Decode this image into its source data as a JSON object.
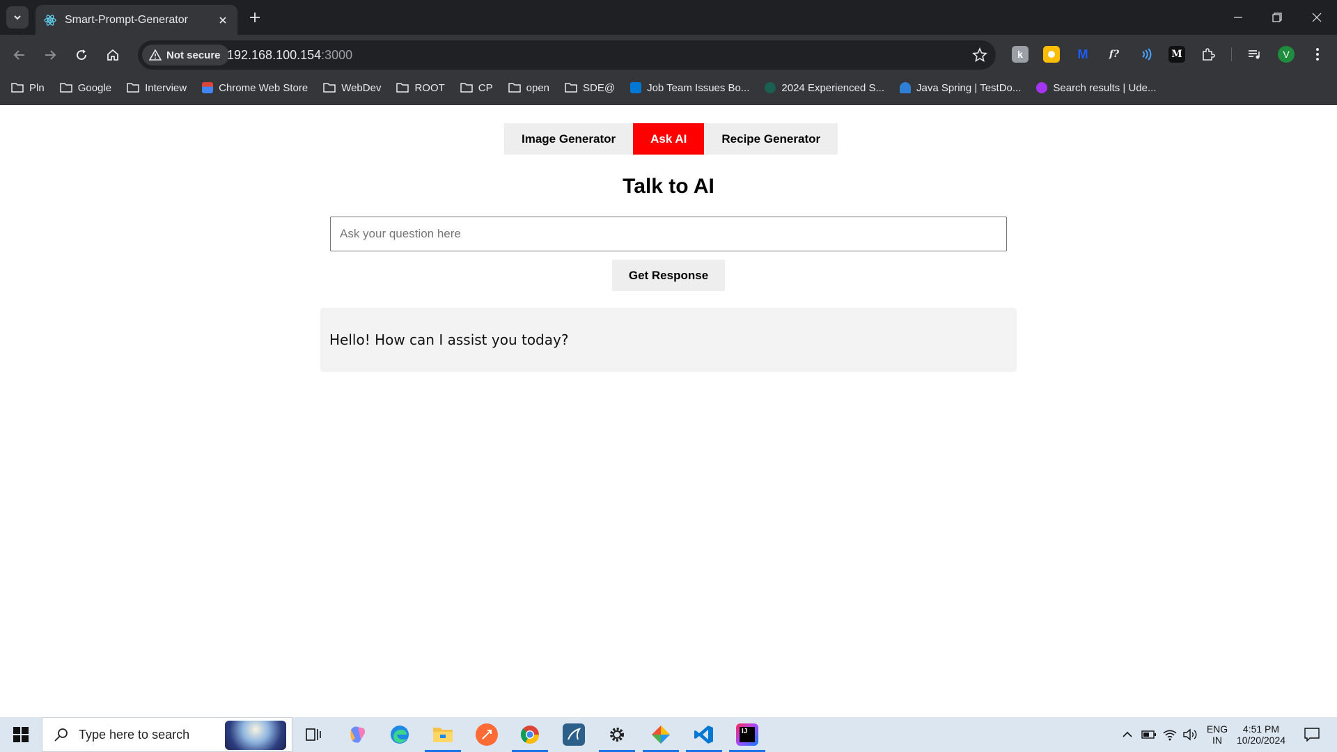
{
  "browser": {
    "tab_title": "Smart-Prompt-Generator",
    "security_label": "Not secure",
    "url_host": "192.168.100.154",
    "url_port": ":3000",
    "profile_initial": "V",
    "extensions": [
      "k-extension-icon",
      "yellow-extension-icon",
      "m-extension-icon",
      "fx-extension-icon",
      "wave-extension-icon",
      "medium-extension-icon"
    ],
    "bookmarks": [
      {
        "label": "Pln",
        "icon": "folder-icon"
      },
      {
        "label": "Google",
        "icon": "folder-icon"
      },
      {
        "label": "Interview",
        "icon": "folder-icon"
      },
      {
        "label": "Chrome Web Store",
        "icon": "chrome-web-store-icon"
      },
      {
        "label": "WebDev",
        "icon": "folder-icon"
      },
      {
        "label": "ROOT",
        "icon": "folder-icon"
      },
      {
        "label": "CP",
        "icon": "folder-icon"
      },
      {
        "label": "open",
        "icon": "folder-icon"
      },
      {
        "label": "SDE@",
        "icon": "folder-icon"
      },
      {
        "label": "Job Team Issues Bo...",
        "icon": "azure-devops-icon"
      },
      {
        "label": "2024 Experienced S...",
        "icon": "site-icon"
      },
      {
        "label": "Java Spring | TestDo...",
        "icon": "testdome-icon"
      },
      {
        "label": "Search results | Ude...",
        "icon": "udemy-icon"
      }
    ]
  },
  "app": {
    "tabs": [
      {
        "label": "Image Generator",
        "active": false
      },
      {
        "label": "Ask AI",
        "active": true
      },
      {
        "label": "Recipe Generator",
        "active": false
      }
    ],
    "title": "Talk to AI",
    "input_placeholder": "Ask your question here",
    "input_value": "",
    "button_label": "Get Response",
    "response": "Hello! How can I assist you today?",
    "accent_color": "#ff0000"
  },
  "taskbar": {
    "search_placeholder": "Type here to search",
    "language_top": "ENG",
    "language_bottom": "IN",
    "time": "4:51 PM",
    "date": "10/20/2024"
  }
}
